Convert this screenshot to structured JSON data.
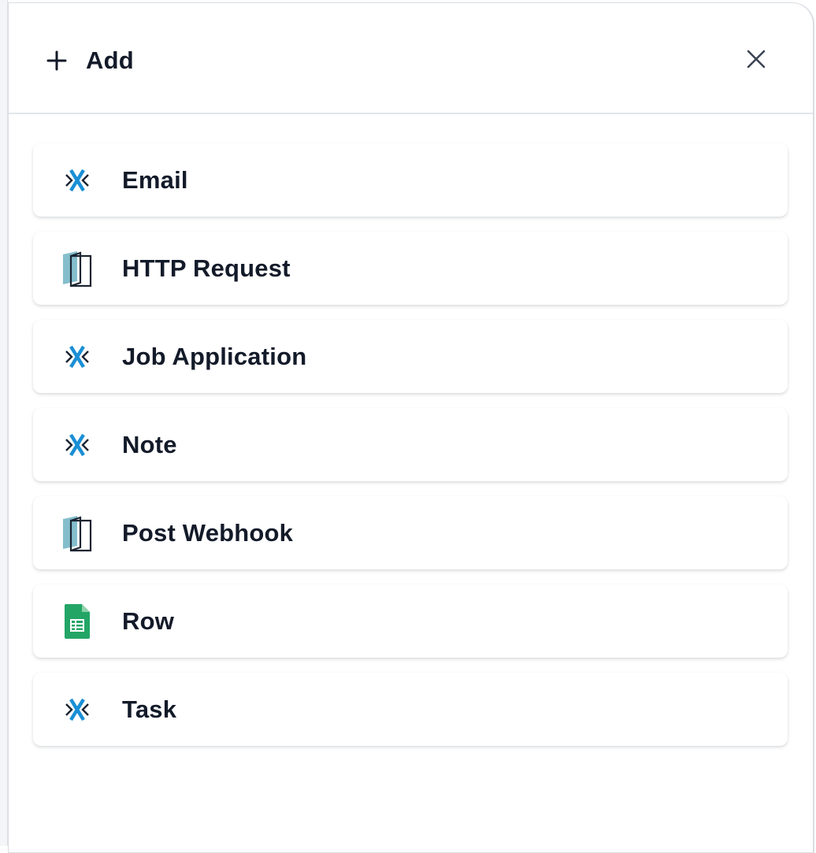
{
  "header": {
    "title": "Add",
    "plus_icon": "plus-icon",
    "close_icon": "close-icon"
  },
  "items": [
    {
      "label": "Email",
      "icon": "crm-x-icon"
    },
    {
      "label": "HTTP Request",
      "icon": "webhook-door-icon"
    },
    {
      "label": "Job Application",
      "icon": "crm-x-icon"
    },
    {
      "label": "Note",
      "icon": "crm-x-icon"
    },
    {
      "label": "Post Webhook",
      "icon": "webhook-door-icon"
    },
    {
      "label": "Row",
      "icon": "spreadsheet-icon"
    },
    {
      "label": "Task",
      "icon": "crm-x-icon"
    }
  ],
  "colors": {
    "text": "#131a29",
    "x_blue": "#1a8fd6",
    "x_dark": "#1b2431",
    "door_teal": "#6fb3c4",
    "sheet_green": "#23a566"
  }
}
